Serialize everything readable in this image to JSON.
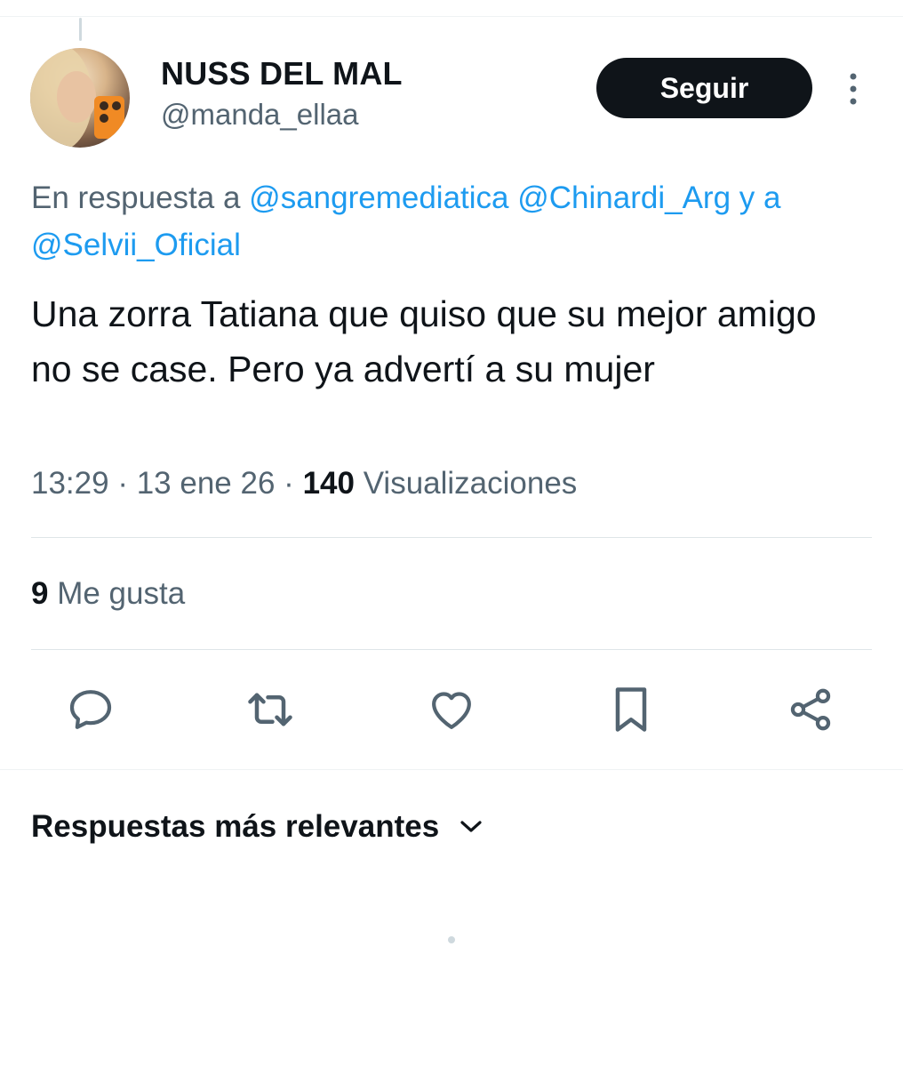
{
  "tweet": {
    "author": {
      "display_name": "NUSS DEL MAL",
      "handle": "@manda_ellaa"
    },
    "follow_label": "Seguir",
    "reply_to": {
      "prefix": "En respuesta a",
      "mention_1": "@sangremediatica",
      "mention_2": "@Chinardi_Arg",
      "connector": "y a",
      "mention_3": "@Selvii_Oficial"
    },
    "text": "Una zorra Tatiana que quiso que su mejor amigo no se case. Pero ya advertí a su mujer",
    "time": "13:29",
    "date": "13 ene 26",
    "views_count": "140",
    "views_label": "Visualizaciones",
    "likes_count": "9",
    "likes_label": "Me gusta"
  },
  "actions": [
    {
      "icon": "reply-icon"
    },
    {
      "icon": "retweet-icon"
    },
    {
      "icon": "like-icon"
    },
    {
      "icon": "bookmark-icon"
    },
    {
      "icon": "share-icon"
    }
  ],
  "replies": {
    "sort_label": "Respuestas más relevantes",
    "sort_icon": "chevron-down-icon"
  },
  "colors": {
    "accent": "#1d9bf0",
    "text_primary": "#0f1419",
    "text_secondary": "#536471",
    "button_bg": "#0f1419"
  }
}
